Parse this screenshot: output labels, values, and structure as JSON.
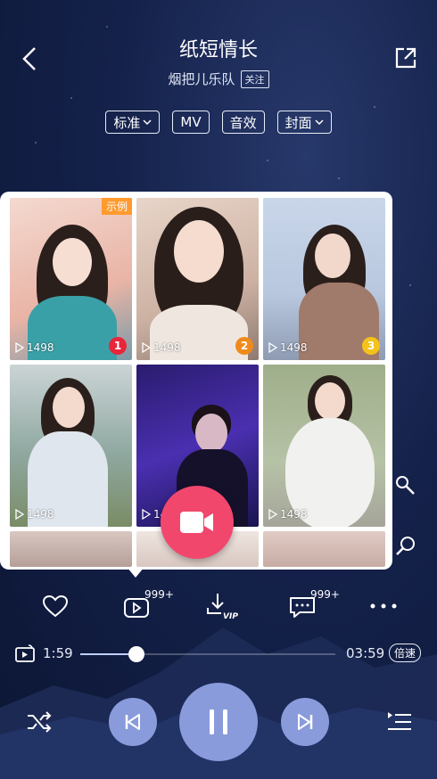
{
  "header": {
    "title": "纸短情长",
    "artist": "烟把儿乐队",
    "follow_label": "关注"
  },
  "chips": [
    {
      "label": "标准",
      "has_dropdown": true
    },
    {
      "label": "MV",
      "has_dropdown": false
    },
    {
      "label": "音效",
      "has_dropdown": false
    },
    {
      "label": "封面",
      "has_dropdown": true
    }
  ],
  "videos": {
    "sample_tag": "示例",
    "items": [
      {
        "plays": "1498",
        "rank": "1"
      },
      {
        "plays": "1498",
        "rank": "2"
      },
      {
        "plays": "1498",
        "rank": "3"
      },
      {
        "plays": "1498"
      },
      {
        "plays": "1498"
      },
      {
        "plays": "1498"
      }
    ]
  },
  "actions": {
    "mv_count": "999+",
    "comment_count": "999+",
    "download_tag": "VIP"
  },
  "playback": {
    "current_time": "1:59",
    "total_time": "03:59",
    "progress": 0.22,
    "speed_label": "倍速"
  },
  "colors": {
    "accent": "#f2476d",
    "control": "#8a9bdc",
    "rank1": "#e8263a",
    "rank2": "#f08a1c",
    "rank3": "#f5c21b",
    "sample_tag": "#ff9a2e"
  }
}
